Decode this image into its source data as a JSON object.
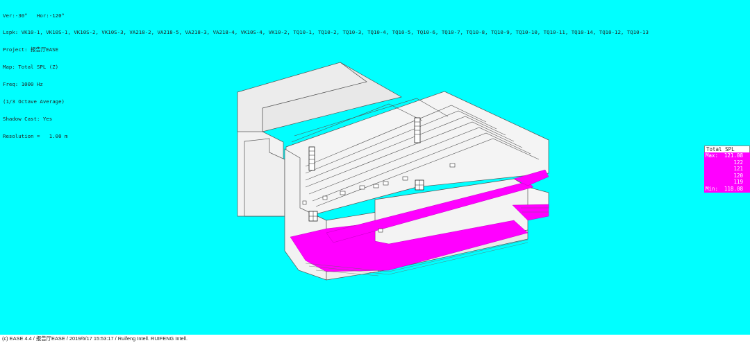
{
  "view": {
    "lines": [
      "Ver:-30°   Hor:-120°",
      "Lspk: VK10-1, VK10S-1, VK10S-2, VK10S-3, VA218-2, VA218-5, VA218-3, VA218-4, VK10S-4, VK10-2, TQ10-1, TQ10-2, TQ10-3, TQ10-4, TQ10-5, TQ10-6, TQ10-7, TQ10-8, TQ10-9, TQ10-10, TQ10-11, TQ10-14, TQ10-12, TQ10-13",
      "Project: 报告厅EASE",
      "Map: Total SPL (Z)",
      "Freq: 1000 Hz",
      "(1/3 Octave Average)",
      "Shadow Cast: Yes",
      "Resolution =   1.00 m"
    ]
  },
  "legend": {
    "title": "Total SPL [dB]",
    "rows": [
      {
        "label": "Max:",
        "value": "121.08"
      },
      {
        "label": "",
        "value": "122"
      },
      {
        "label": "",
        "value": "121"
      },
      {
        "label": "",
        "value": "120"
      },
      {
        "label": "",
        "value": "119"
      },
      {
        "label": "Min:",
        "value": "118.08"
      }
    ],
    "color": "#ff00ff"
  },
  "footer": {
    "text": "(c) EASE 4.4 / 报告厅EASE  / 2019/6/17 15:53:17 / Ruifeng Intell. RUIFENG Intell."
  },
  "colors": {
    "background": "#00ffff",
    "spl_map": "#ff00ff",
    "model_face": "#f2f2f2"
  }
}
